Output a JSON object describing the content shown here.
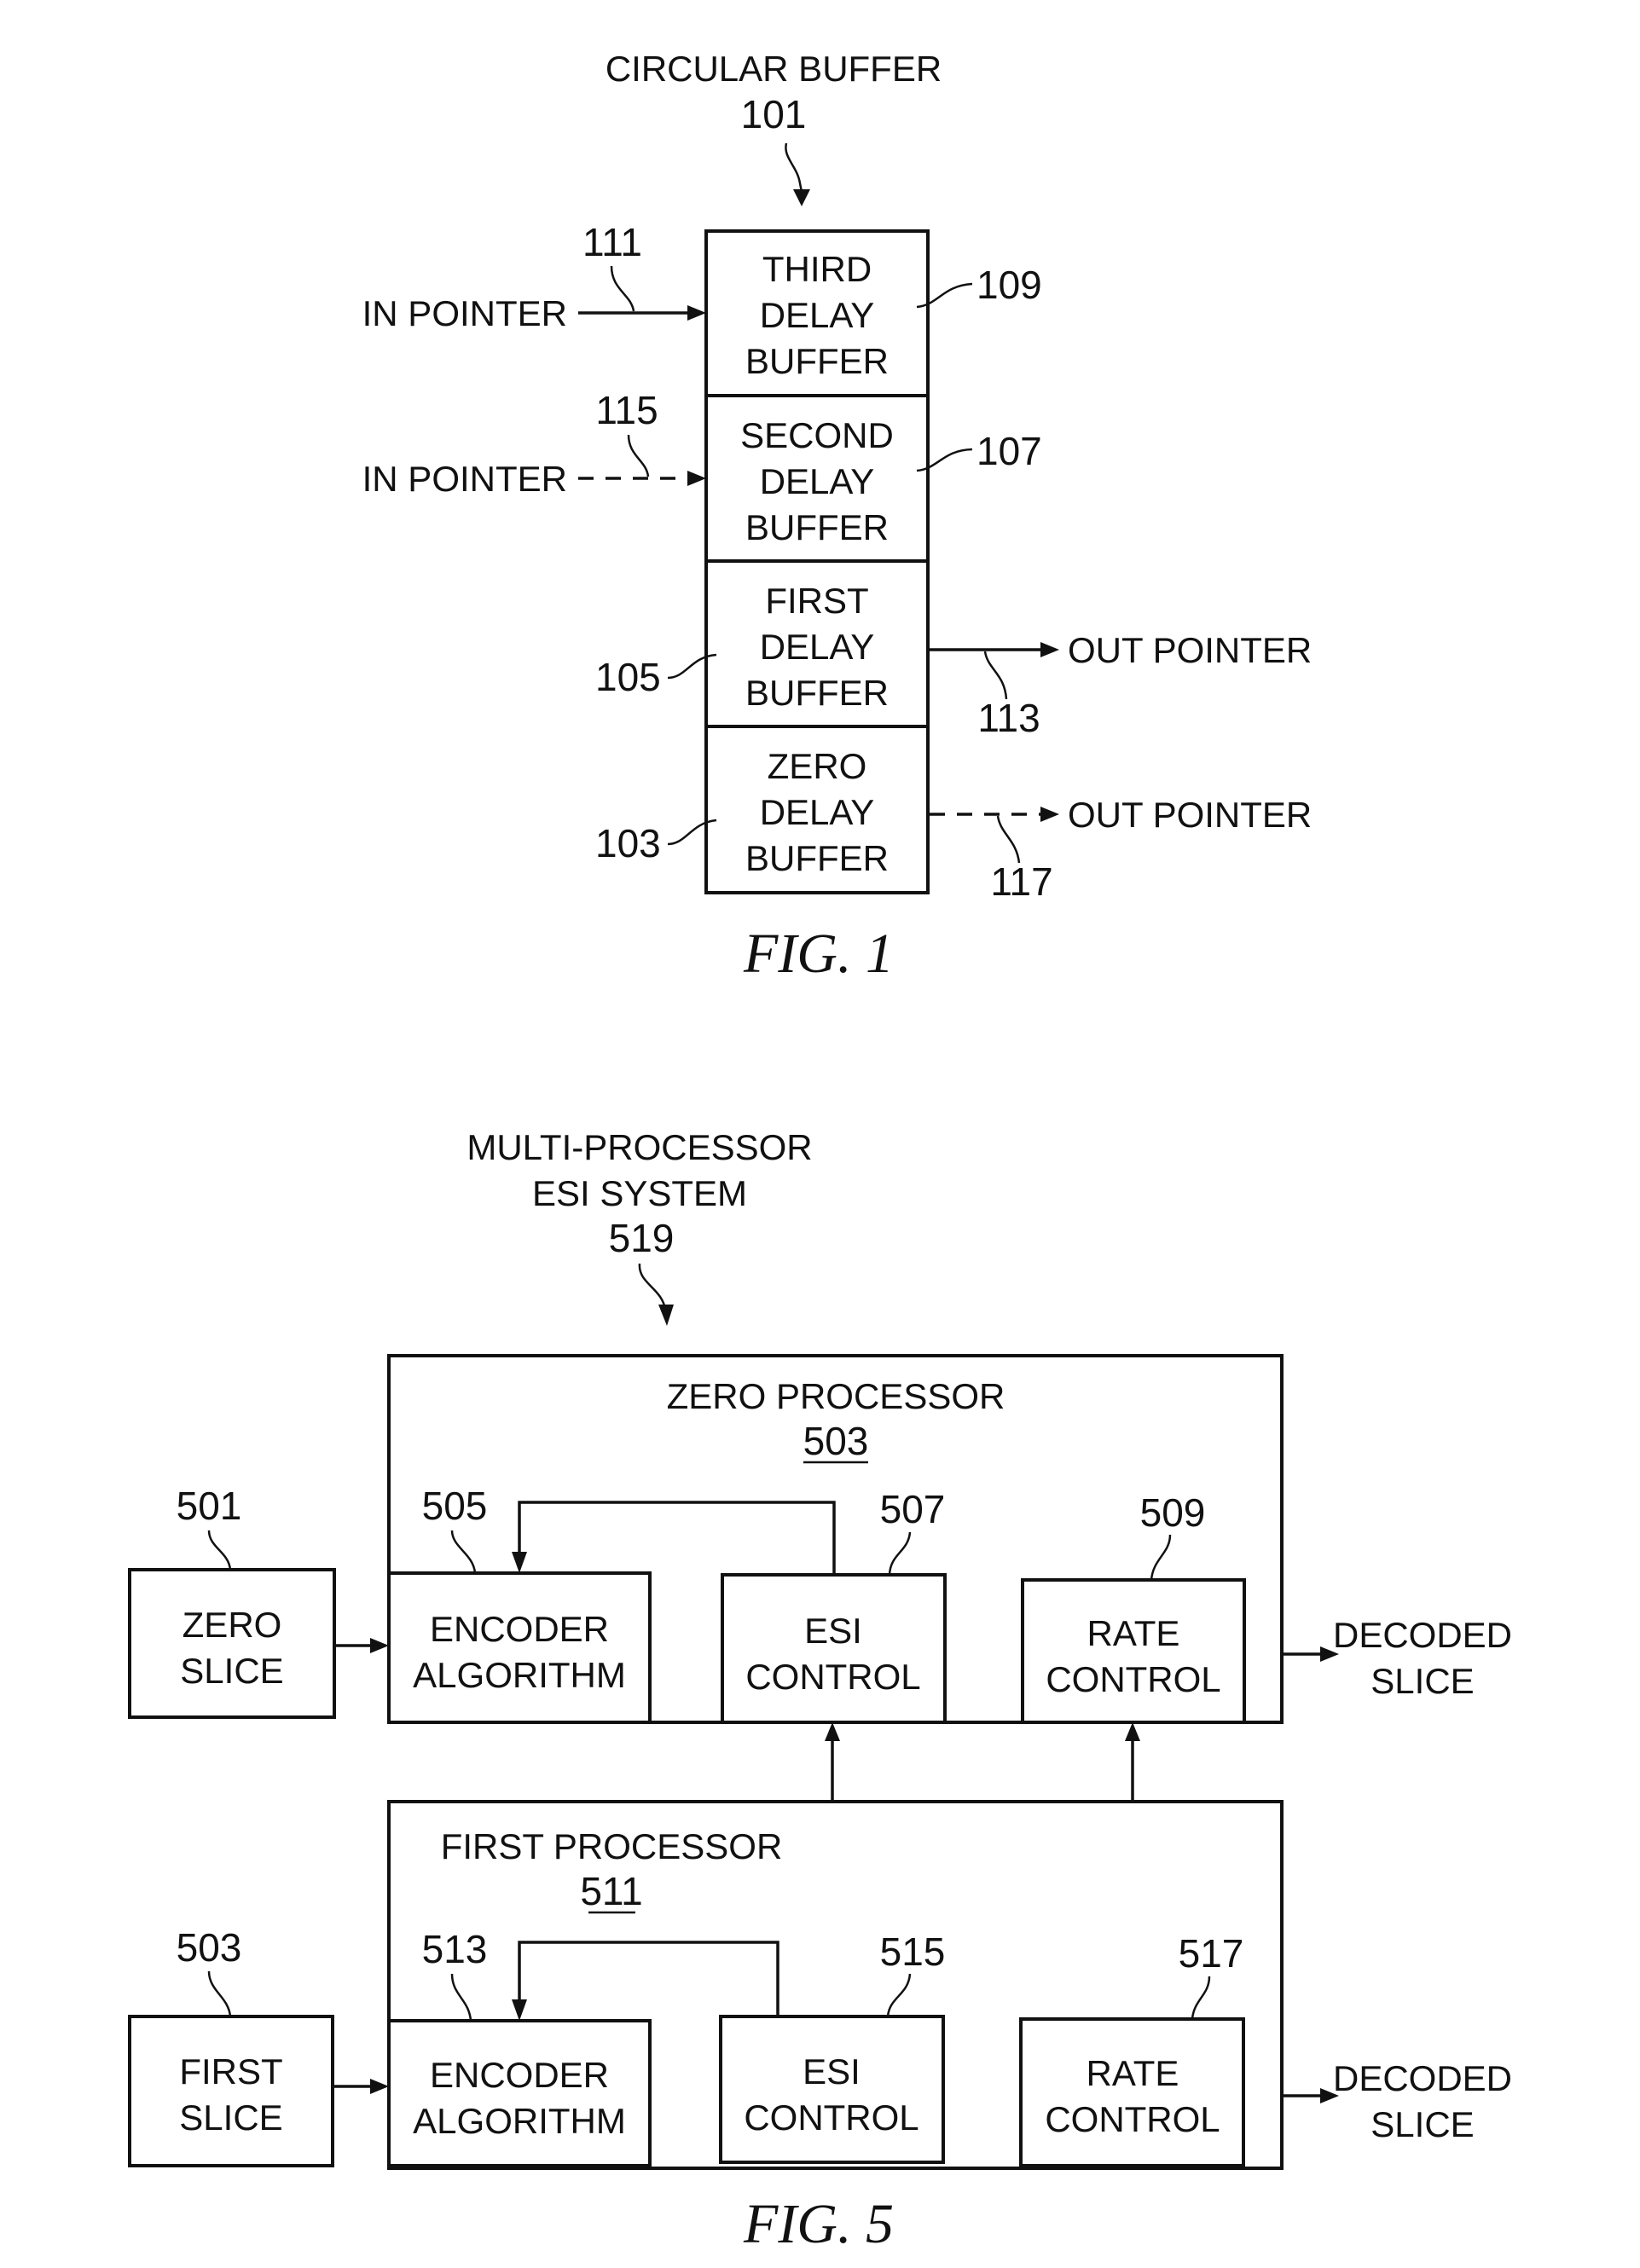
{
  "fig1": {
    "caption": "FIG. 1",
    "title": "CIRCULAR BUFFER",
    "title_ref": "101",
    "cells": [
      {
        "lines": [
          "THIRD",
          "DELAY",
          "BUFFER"
        ],
        "ref": "109"
      },
      {
        "lines": [
          "SECOND",
          "DELAY",
          "BUFFER"
        ],
        "ref": "107"
      },
      {
        "lines": [
          "FIRST",
          "DELAY",
          "BUFFER"
        ],
        "ref": "105"
      },
      {
        "lines": [
          "ZERO",
          "DELAY",
          "BUFFER"
        ],
        "ref": "103"
      }
    ],
    "in_pointers": [
      {
        "label": "IN POINTER",
        "ref": "111",
        "style": "solid"
      },
      {
        "label": "IN POINTER",
        "ref": "115",
        "style": "dashed"
      }
    ],
    "out_pointers": [
      {
        "label": "OUT POINTER",
        "ref": "113",
        "style": "solid"
      },
      {
        "label": "OUT POINTER",
        "ref": "117",
        "style": "dashed"
      }
    ]
  },
  "fig5": {
    "caption": "FIG. 5",
    "system_title": [
      "MULTI-PROCESSOR",
      "ESI SYSTEM"
    ],
    "system_ref": "519",
    "processors": [
      {
        "title": "ZERO PROCESSOR",
        "ref": "503",
        "slice": {
          "lines": [
            "ZERO",
            "SLICE"
          ],
          "ref": "501"
        },
        "encoder": {
          "lines": [
            "ENCODER",
            "ALGORITHM"
          ],
          "ref": "505"
        },
        "esi": {
          "lines": [
            "ESI",
            "CONTROL"
          ],
          "ref": "507"
        },
        "rate": {
          "lines": [
            "RATE",
            "CONTROL"
          ],
          "ref": "509"
        },
        "output": [
          "DECODED",
          "SLICE"
        ]
      },
      {
        "title": "FIRST PROCESSOR",
        "ref": "511",
        "slice": {
          "lines": [
            "FIRST",
            "SLICE"
          ],
          "ref": "503"
        },
        "encoder": {
          "lines": [
            "ENCODER",
            "ALGORITHM"
          ],
          "ref": "513"
        },
        "esi": {
          "lines": [
            "ESI",
            "CONTROL"
          ],
          "ref": "515"
        },
        "rate": {
          "lines": [
            "RATE",
            "CONTROL"
          ],
          "ref": "517"
        },
        "output": [
          "DECODED",
          "SLICE"
        ]
      }
    ]
  }
}
